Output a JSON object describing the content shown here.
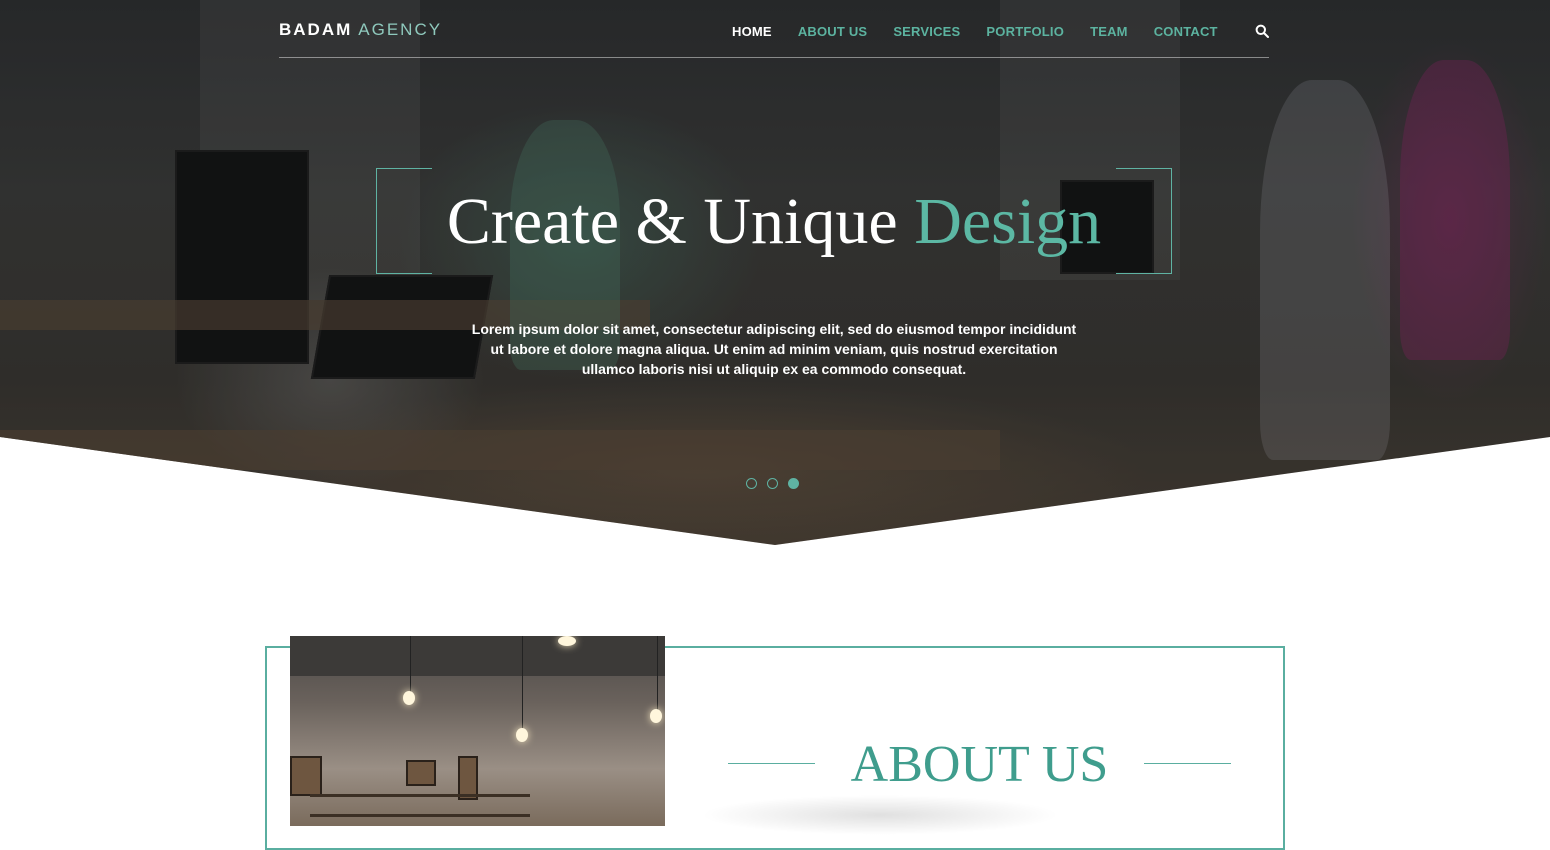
{
  "brand": {
    "bold": "BADAM",
    "light": "AGENCY"
  },
  "nav": {
    "items": [
      {
        "label": "HOME",
        "active": true
      },
      {
        "label": "ABOUT US",
        "active": false
      },
      {
        "label": "SERVICES",
        "active": false
      },
      {
        "label": "PORTFOLIO",
        "active": false
      },
      {
        "label": "TEAM",
        "active": false
      },
      {
        "label": "CONTACT",
        "active": false
      }
    ],
    "search_icon": "search-icon"
  },
  "hero": {
    "title_main": "Create & Unique",
    "title_accent": "Design",
    "text": "Lorem ipsum dolor sit amet, consectetur adipiscing elit, sed do eiusmod tempor incididunt ut labore et dolore magna aliqua. Ut enim ad minim veniam, quis nostrud exercitation ullamco laboris nisi ut aliquip ex ea commodo consequat.",
    "slides": {
      "count": 3,
      "active_index": 2
    }
  },
  "about": {
    "title": "ABOUT US"
  },
  "colors": {
    "accent": "#5cb3a0",
    "dark_accent": "#3f9d8d",
    "white": "#ffffff"
  }
}
